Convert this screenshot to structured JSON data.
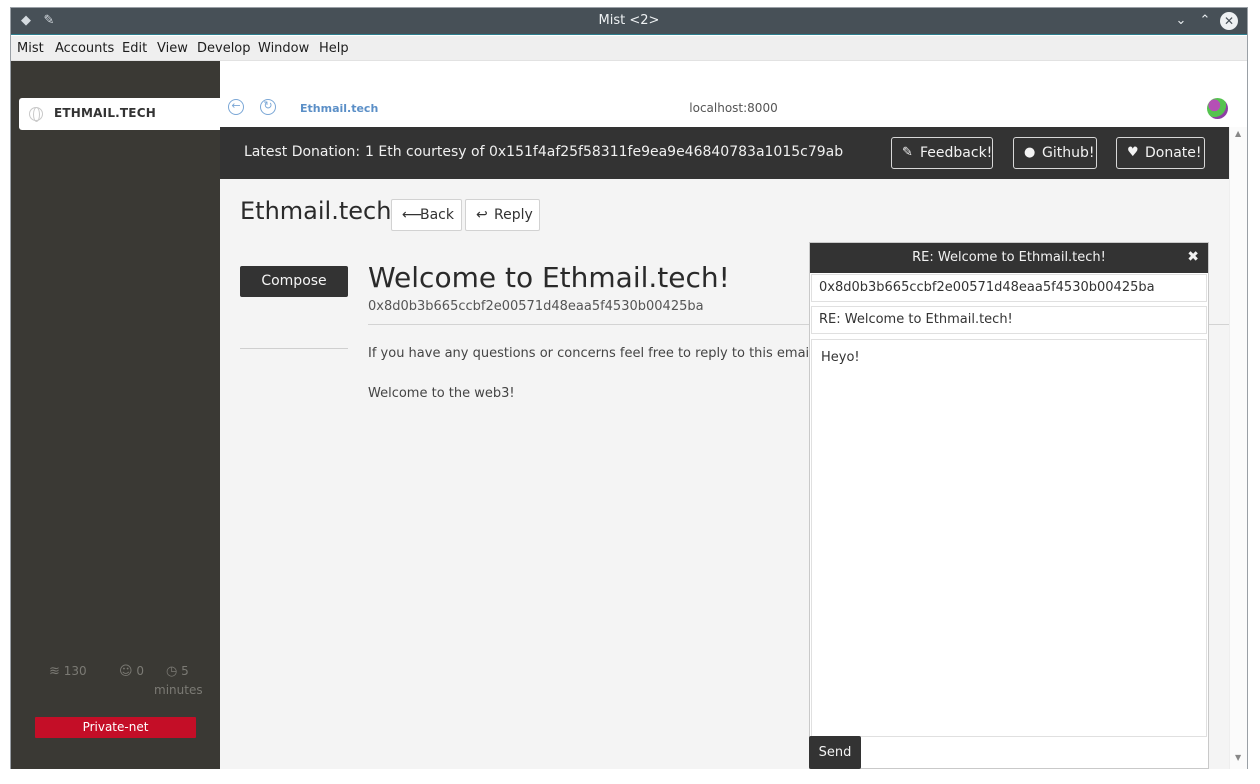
{
  "window": {
    "title": "Mist <2>"
  },
  "menu": [
    "Mist",
    "Accounts",
    "Edit",
    "View",
    "Develop",
    "Window",
    "Help"
  ],
  "sidebar": {
    "tab_label": "ETHMAIL.TECH",
    "stats": {
      "blocks": "130",
      "peers": "0",
      "time_value": "5",
      "time_unit": "minutes"
    },
    "network": "Private-net"
  },
  "browser": {
    "breadcrumb": "Ethmail.tech",
    "url": "localhost:8000"
  },
  "banner": {
    "label": "Latest Donation:",
    "value": "1 Eth courtesy of 0x151f4af25f58311fe9ea9e46840783a1015c79ab",
    "feedback": "Feedback!",
    "github": "Github!",
    "donate": "Donate!"
  },
  "app": {
    "title": "Ethmail.tech",
    "back": "Back",
    "reply": "Reply",
    "compose": "Compose"
  },
  "mail": {
    "subject": "Welcome to Ethmail.tech!",
    "from": "0x8d0b3b665ccbf2e00571d48eaa5f4530b00425ba",
    "body1": "If you have any questions or concerns feel free to reply to this email or p",
    "body2": "Welcome to the web3!"
  },
  "reply_panel": {
    "title": "RE: Welcome to Ethmail.tech!",
    "to": "0x8d0b3b665ccbf2e00571d48eaa5f4530b00425ba",
    "subject": "RE: Welcome to Ethmail.tech!",
    "body": "Heyo!",
    "send": "Send"
  }
}
